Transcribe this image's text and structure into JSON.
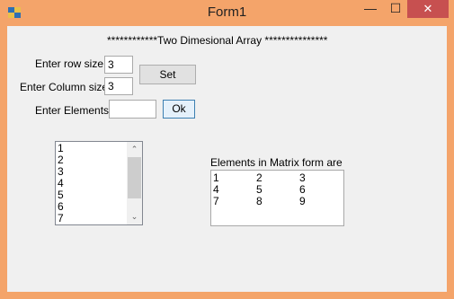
{
  "window": {
    "title": "Form1",
    "minimize_glyph": "—",
    "maximize_glyph": "☐",
    "close_glyph": "✕"
  },
  "form": {
    "header": "************Two Dimesional Array ***************",
    "row_size_label": "Enter row  size",
    "row_size_value": "3",
    "column_size_label": "Enter Column size",
    "column_size_value": "3",
    "set_button": "Set",
    "elements_label": "Enter Elements",
    "elements_value": "",
    "ok_button": "Ok"
  },
  "elements_list": {
    "items": [
      "1",
      "2",
      "3",
      "4",
      "5",
      "6",
      "7"
    ],
    "scroll_up": "⌃",
    "scroll_down": "⌄"
  },
  "matrix": {
    "label": "Elements in Matrix form are",
    "rows": [
      [
        "1",
        "2",
        "3"
      ],
      [
        "4",
        "5",
        "6"
      ],
      [
        "7",
        "8",
        "9"
      ]
    ]
  },
  "colors": {
    "titlebar": "#f4a46a",
    "close_button": "#c75050",
    "client_bg": "#f0f0f0"
  },
  "icons": {
    "app": "app-icon",
    "minimize": "minimize-icon",
    "maximize": "maximize-icon",
    "close": "close-icon"
  }
}
